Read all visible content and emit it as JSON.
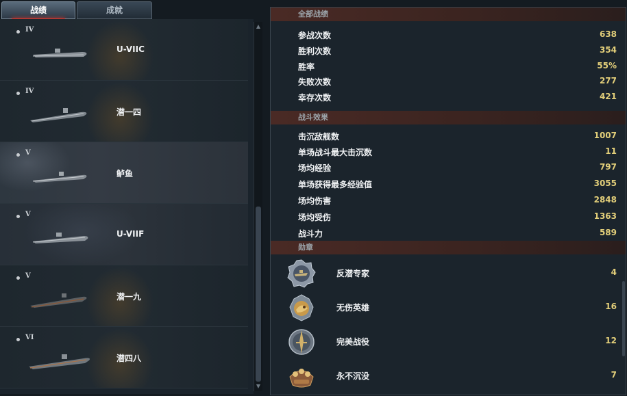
{
  "tabs": [
    {
      "label": "战绩",
      "active": true
    },
    {
      "label": "成就",
      "active": false
    }
  ],
  "ships": [
    {
      "tier": "IV",
      "name": "U-VIIC"
    },
    {
      "tier": "IV",
      "name": "潜一四"
    },
    {
      "tier": "V",
      "name": "鲈鱼"
    },
    {
      "tier": "V",
      "name": "U-VIIF"
    },
    {
      "tier": "V",
      "name": "潜一九"
    },
    {
      "tier": "VI",
      "name": "潜四八"
    }
  ],
  "stats": {
    "overall": {
      "title": "全部战绩",
      "rows": [
        {
          "label": "参战次数",
          "value": "638"
        },
        {
          "label": "胜利次数",
          "value": "354"
        },
        {
          "label": "胜率",
          "value": "55%"
        },
        {
          "label": "失败次数",
          "value": "277"
        },
        {
          "label": "幸存次数",
          "value": "421"
        }
      ]
    },
    "combat": {
      "title": "战斗效果",
      "rows": [
        {
          "label": "击沉敌舰数",
          "value": "1007"
        },
        {
          "label": "单场战斗最大击沉数",
          "value": "11"
        },
        {
          "label": "场均经验",
          "value": "797"
        },
        {
          "label": "单场获得最多经验值",
          "value": "3055"
        },
        {
          "label": "场均伤害",
          "value": "2848"
        },
        {
          "label": "场均受伤",
          "value": "1363"
        },
        {
          "label": "战斗力",
          "value": "589"
        }
      ]
    },
    "medals": {
      "title": "勋章",
      "rows": [
        {
          "name": "反潜专家",
          "count": "4",
          "icon": "anti-sub-medal-icon"
        },
        {
          "name": "无伤英雄",
          "count": "16",
          "icon": "unscathed-hero-medal-icon"
        },
        {
          "name": "完美战役",
          "count": "12",
          "icon": "perfect-battle-medal-icon"
        },
        {
          "name": "永不沉没",
          "count": "7",
          "icon": "unsinkable-medal-icon"
        }
      ]
    }
  },
  "colors": {
    "accent_red": "#e0392e",
    "value_gold": "#e3cf7a",
    "section_header": "#4a2a25"
  }
}
